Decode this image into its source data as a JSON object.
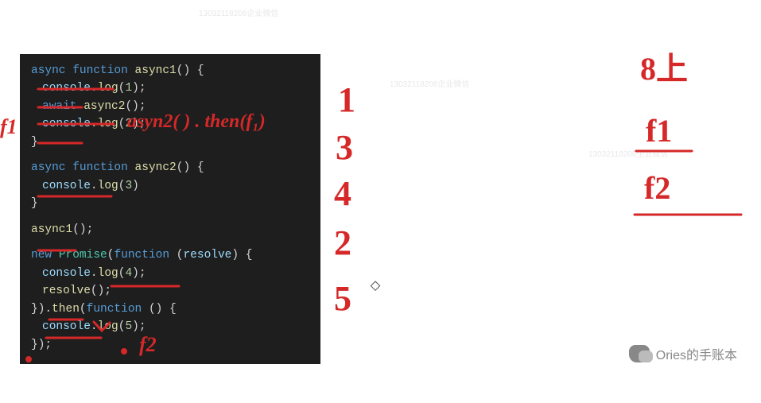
{
  "watermarks": {
    "text": "13032118206企业微信"
  },
  "code": {
    "l1": {
      "kw1": "async",
      "kw2": "function",
      "fn": "async1",
      "pun": "() {"
    },
    "l2": {
      "obj": "console",
      "fn": "log",
      "num": "1",
      "pun1": ".",
      "pun2": "(",
      "pun3": ");"
    },
    "l3": {
      "kw": "await",
      "fn": "async2",
      "pun": "();"
    },
    "l4": {
      "obj": "console",
      "fn": "log",
      "num": "2",
      "pun1": ".",
      "pun2": "(",
      "pun3": ");"
    },
    "l5": {
      "pun": "}"
    },
    "l6": {
      "kw1": "async",
      "kw2": "function",
      "fn": "async2",
      "pun": "() {"
    },
    "l7": {
      "obj": "console",
      "fn": "log",
      "num": "3",
      "pun1": ".",
      "pun2": "(",
      "pun3": ")"
    },
    "l8": {
      "pun": "}"
    },
    "l9": {
      "fn": "async1",
      "pun": "();"
    },
    "l10": {
      "kw1": "new",
      "cls": "Promise",
      "pun1": "(",
      "kw2": "function",
      "pun2": " (",
      "obj": "resolve",
      "pun3": ") {"
    },
    "l11": {
      "obj": "console",
      "fn": "log",
      "num": "4",
      "pun1": ".",
      "pun2": "(",
      "pun3": ");"
    },
    "l12": {
      "fn": "resolve",
      "pun": "();"
    },
    "l13": {
      "pun1": "}).",
      "fn": "then",
      "pun2": "(",
      "kw": "function",
      "pun3": " () {"
    },
    "l14": {
      "obj": "console",
      "fn": "log",
      "num": "5",
      "pun1": ".",
      "pun2": "(",
      "pun3": ");"
    },
    "l15": {
      "pun": "});"
    }
  },
  "annotations": {
    "left_label": "f1",
    "then_annotation": "asyn2( ) . then(f₁)",
    "f2_label": "f2",
    "output_sequence": [
      "1",
      "3",
      "4",
      "2",
      "5"
    ],
    "right_top": "8上",
    "right_f1": "f1",
    "right_f2": "f2"
  },
  "channel": {
    "name": "Ories的手账本"
  }
}
